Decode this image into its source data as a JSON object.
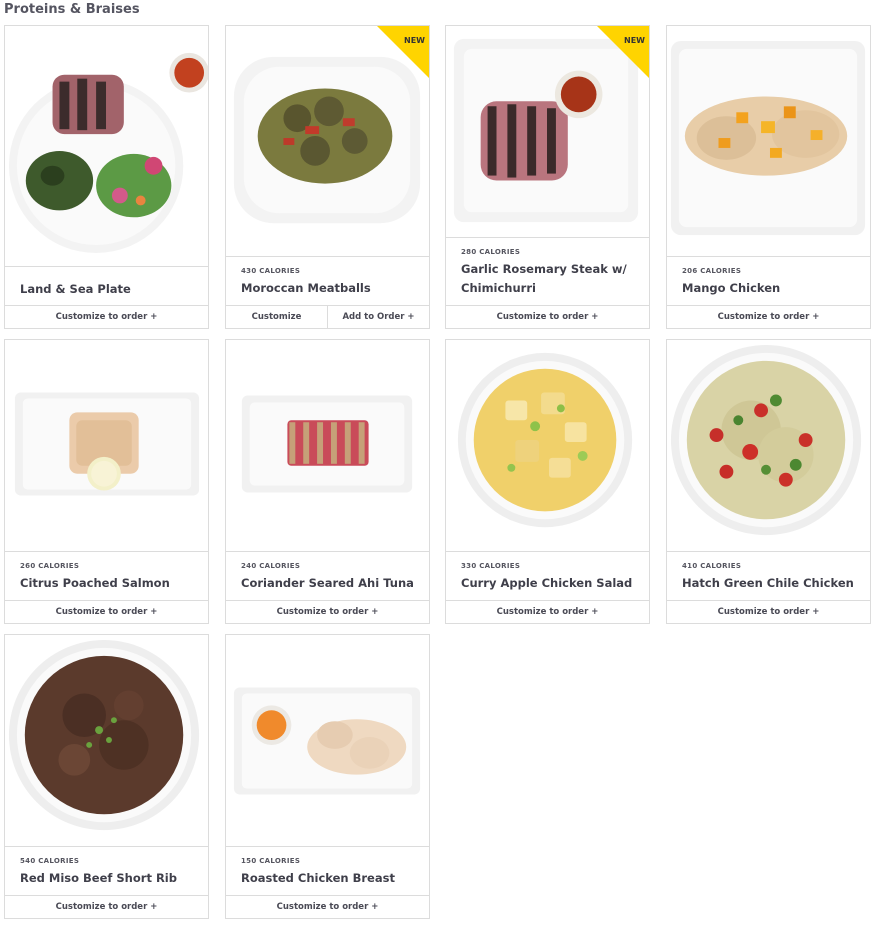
{
  "section": {
    "title": "Proteins & Braises"
  },
  "items": [
    {
      "name": "Land & Sea Plate",
      "calories": "",
      "badge": "",
      "action": "Customize to order +"
    },
    {
      "name": "Moroccan Meatballs",
      "calories": "430 CALORIES",
      "badge": "NEW",
      "action_left": "Customize",
      "action_right": "Add to Order +"
    },
    {
      "name": "Garlic Rosemary Steak w/ Chimichurri",
      "calories": "280 CALORIES",
      "badge": "NEW",
      "action": "Customize to order +"
    },
    {
      "name": "Mango Chicken",
      "calories": "206 CALORIES",
      "badge": "",
      "action": "Customize to order +"
    },
    {
      "name": "Citrus Poached Salmon",
      "calories": "260 CALORIES",
      "badge": "",
      "action": "Customize to order +"
    },
    {
      "name": "Coriander Seared Ahi Tuna",
      "calories": "240 CALORIES",
      "badge": "",
      "action": "Customize to order +"
    },
    {
      "name": "Curry Apple Chicken Salad",
      "calories": "330 CALORIES",
      "badge": "",
      "action": "Customize to order +"
    },
    {
      "name": "Hatch Green Chile Chicken",
      "calories": "410 CALORIES",
      "badge": "",
      "action": "Customize to order +"
    },
    {
      "name": "Red Miso Beef Short Rib",
      "calories": "540 CALORIES",
      "badge": "",
      "action": "Customize to order +"
    },
    {
      "name": "Roasted Chicken Breast",
      "calories": "150 CALORIES",
      "badge": "",
      "action": "Customize to order +"
    }
  ],
  "colors": {
    "badge": "#ffd400",
    "border": "#dcdcdc",
    "text": "#3f3f4a"
  }
}
